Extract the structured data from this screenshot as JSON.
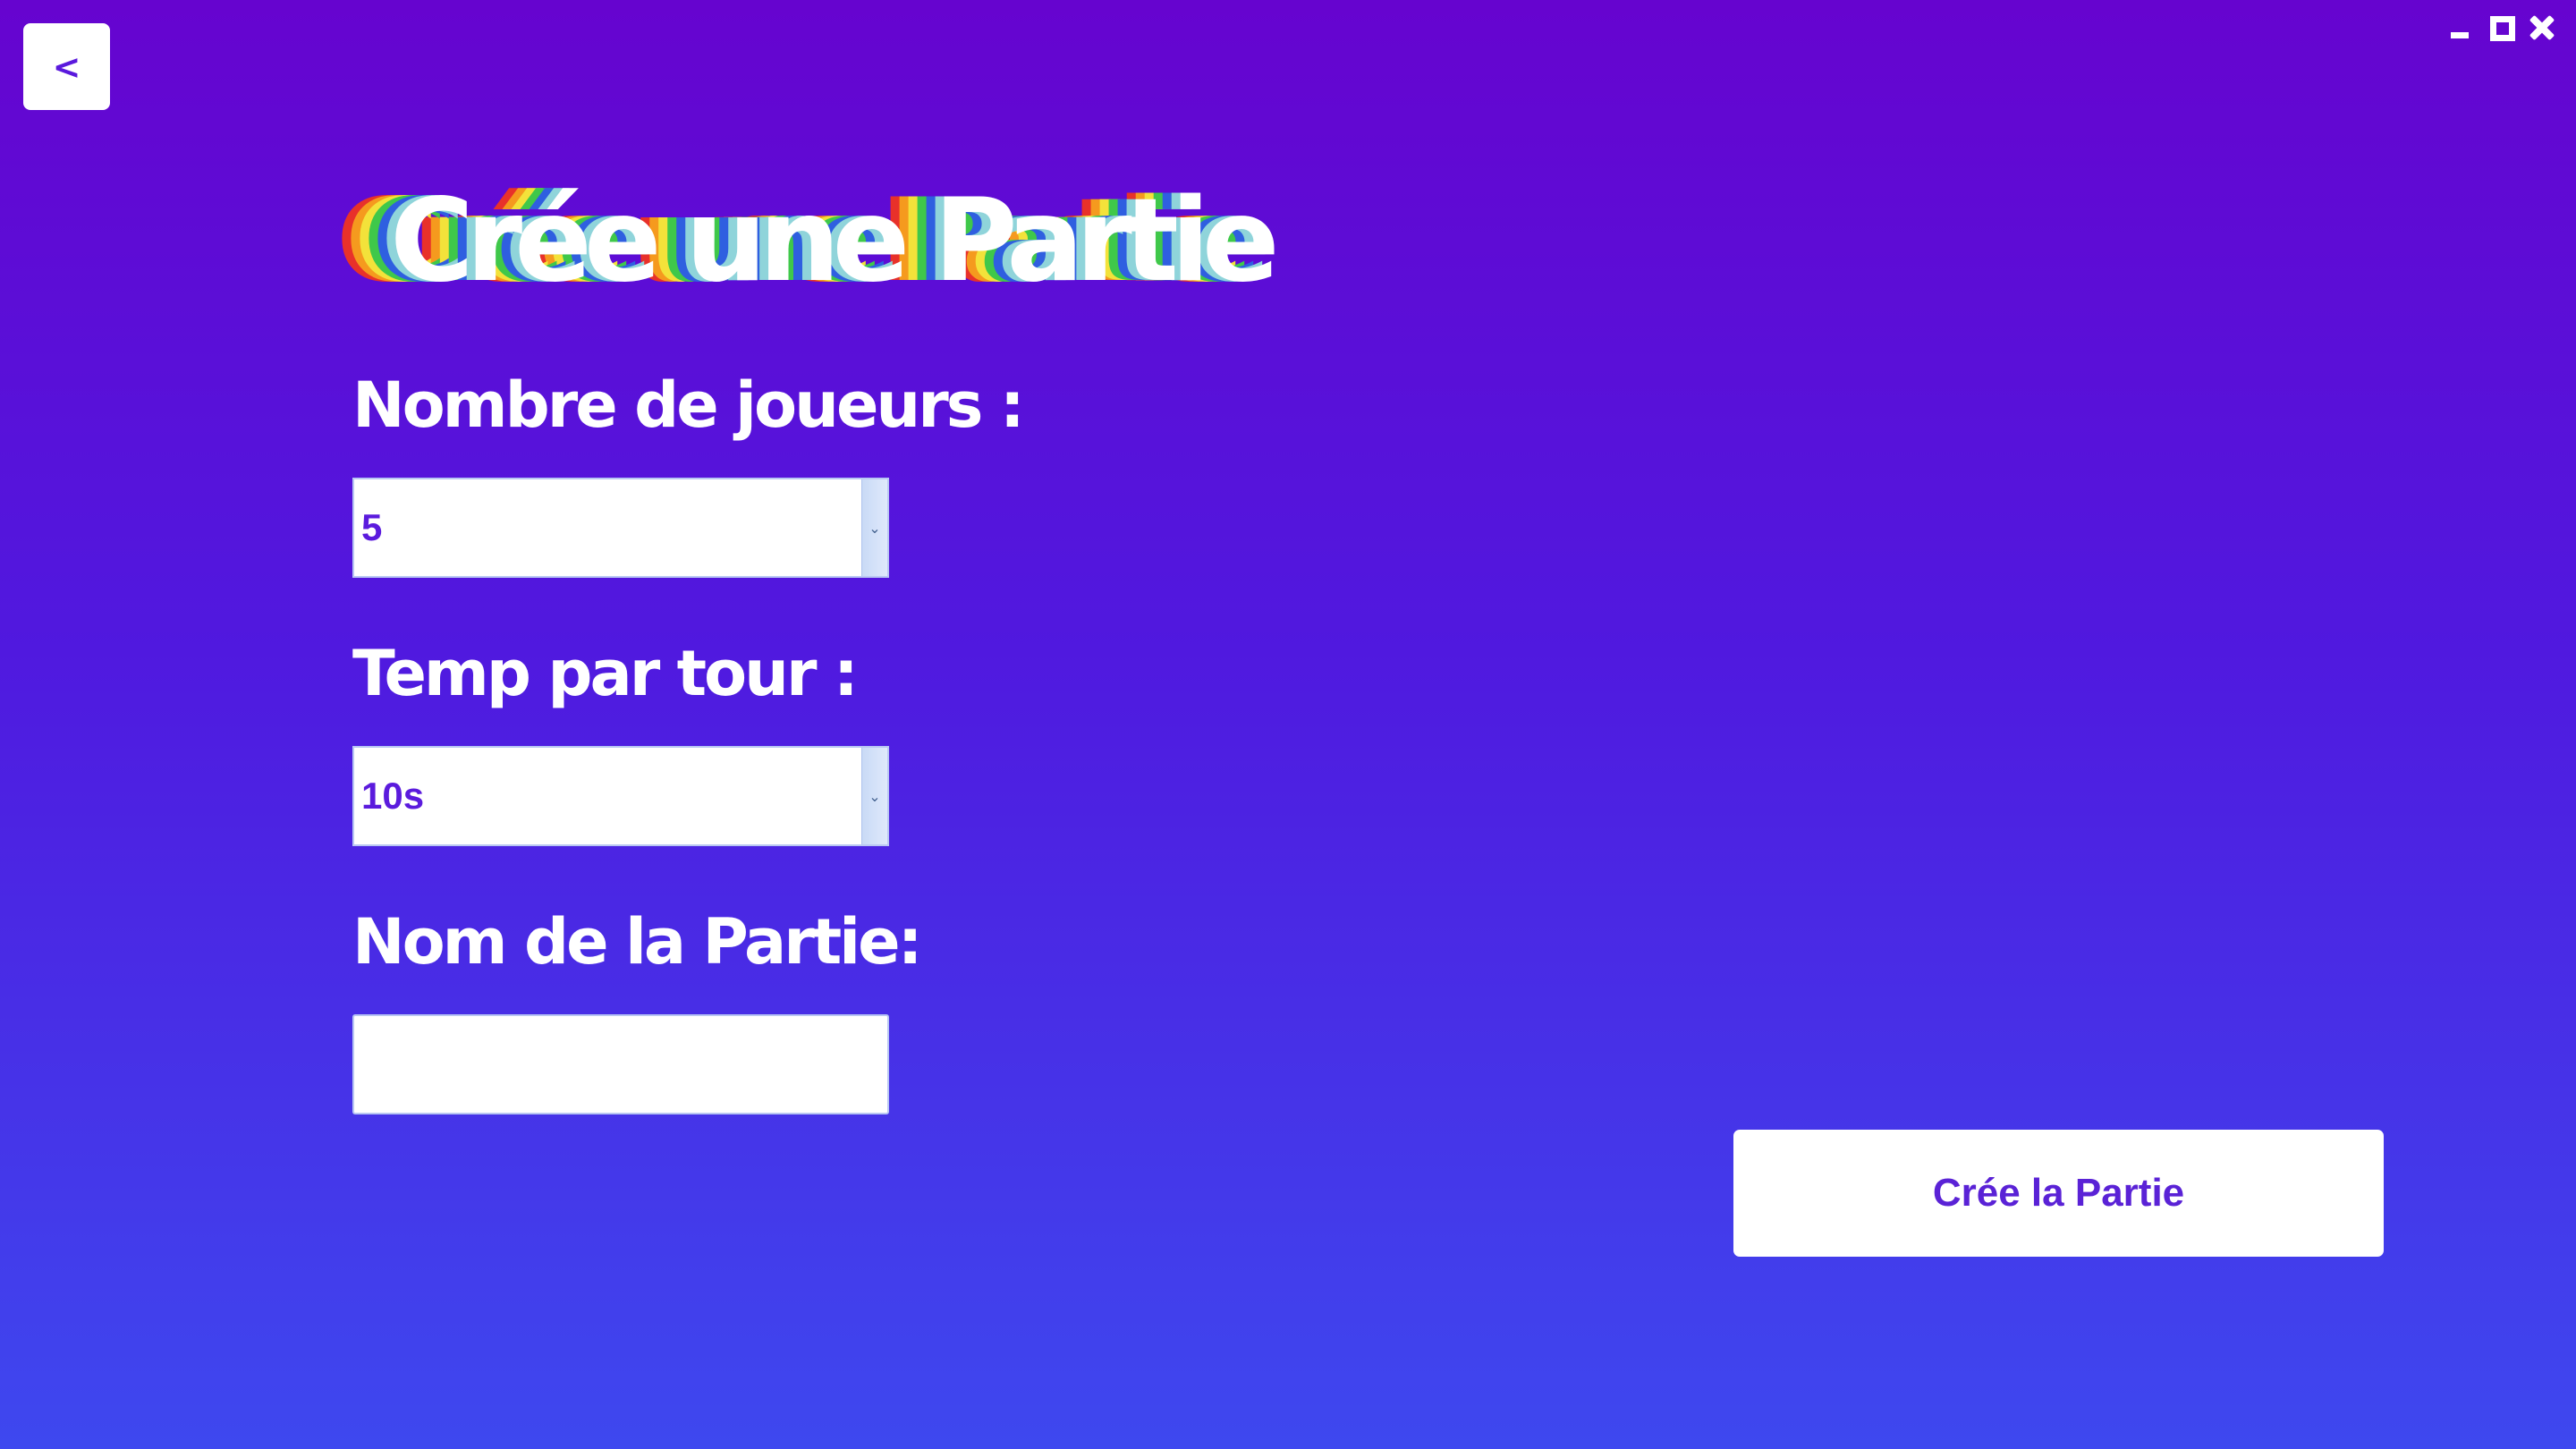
{
  "nav": {
    "back_label": "<"
  },
  "window": {
    "controls": [
      "minimize-icon",
      "maximize-icon",
      "close-icon"
    ]
  },
  "page": {
    "title": "Crée une Partie"
  },
  "form": {
    "players": {
      "label": "Nombre de joueurs :",
      "selected": "5"
    },
    "turn_time": {
      "label": "Temp par tour :",
      "selected": "10s"
    },
    "game_name": {
      "label": "Nom de la Partie:",
      "value": ""
    },
    "submit_label": "Crée la Partie"
  },
  "colors": {
    "background_top": "#6604cf",
    "background_bottom": "#3e48ef",
    "accent_text": "#5a22d6",
    "title_shadow_layers": [
      "#8fd4da",
      "#2f5fe0",
      "#3fc84a",
      "#f3e23a",
      "#f59a1e",
      "#e8312a"
    ]
  }
}
